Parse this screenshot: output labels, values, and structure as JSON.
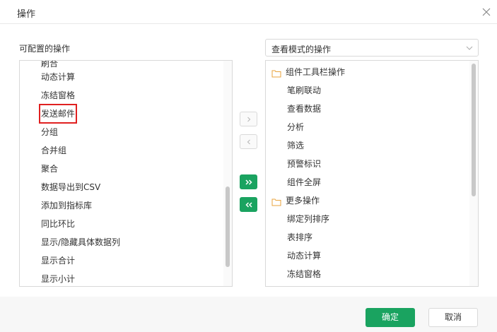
{
  "dialog": {
    "title": "操作"
  },
  "left_panel": {
    "label": "可配置的操作",
    "items": [
      "刷合",
      "动态计算",
      "冻结窗格",
      "发送邮件",
      "分组",
      "合并组",
      "聚合",
      "数据导出到CSV",
      "添加到指标库",
      "同比环比",
      "显示/隐藏具体数据列",
      "显示合计",
      "显示小计"
    ],
    "highlighted_item": "发送邮件"
  },
  "right_panel": {
    "mode_select": {
      "value": "查看模式的操作"
    },
    "items": [
      {
        "label": "组件工具栏操作",
        "type": "folder"
      },
      {
        "label": "笔刷联动",
        "type": "item"
      },
      {
        "label": "查看数据",
        "type": "item"
      },
      {
        "label": "分析",
        "type": "item"
      },
      {
        "label": "筛选",
        "type": "item"
      },
      {
        "label": "预警标识",
        "type": "item"
      },
      {
        "label": "组件全屏",
        "type": "item"
      },
      {
        "label": "更多操作",
        "type": "folder"
      },
      {
        "label": "绑定列排序",
        "type": "item"
      },
      {
        "label": "表排序",
        "type": "item"
      },
      {
        "label": "动态计算",
        "type": "item"
      },
      {
        "label": "冻结窗格",
        "type": "item"
      }
    ]
  },
  "transfer_buttons": {
    "move_right": "›",
    "move_left": "‹",
    "move_all_right": "»",
    "move_all_left": "«"
  },
  "footer": {
    "ok_label": "确定",
    "cancel_label": "取消"
  },
  "colors": {
    "primary": "#1aa360",
    "highlight_border": "#e02020",
    "folder_icon": "#e8a33d"
  },
  "icons": [
    "close-icon",
    "chevron-down-icon",
    "folder-icon"
  ]
}
